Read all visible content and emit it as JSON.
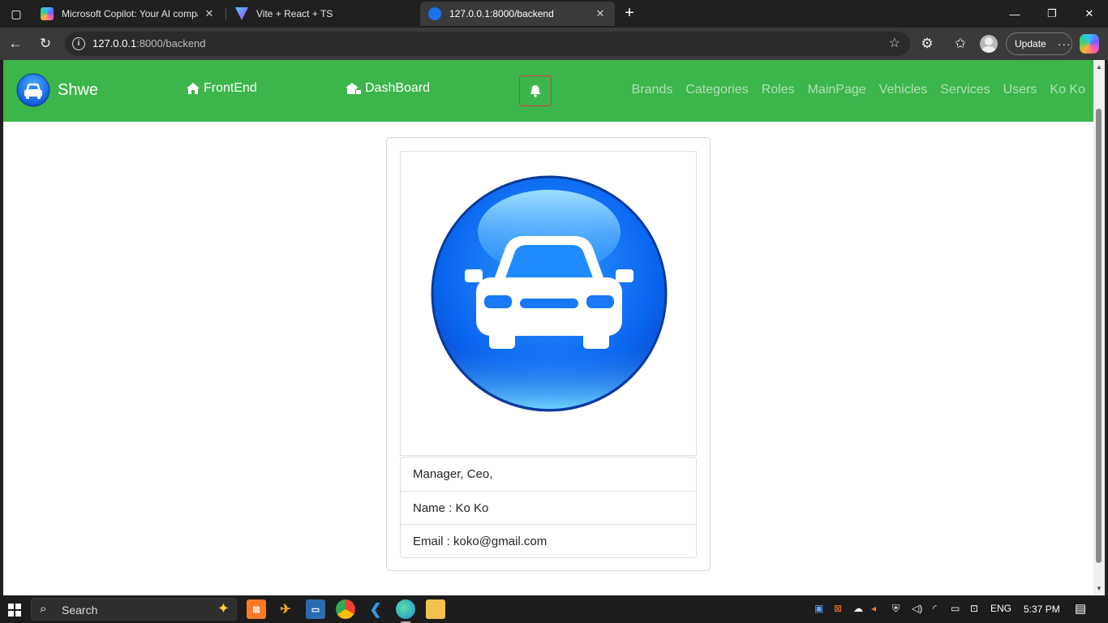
{
  "browser": {
    "tabs": [
      {
        "title": "Microsoft Copilot: Your AI compa",
        "active": false
      },
      {
        "title": "Vite + React + TS",
        "active": false
      },
      {
        "title": "127.0.0.1:8000/backend",
        "active": true
      }
    ],
    "url_host": "127.0.0.1",
    "url_rest": ":8000/backend",
    "update_label": "Update"
  },
  "app": {
    "brand": "Shwe",
    "frontend_label": "FrontEnd",
    "dashboard_label": "DashBoard",
    "menu": [
      "Brands",
      "Categories",
      "Roles",
      "MainPage",
      "Vehicles",
      "Services",
      "Users",
      "Ko Ko"
    ]
  },
  "profile": {
    "roles": "Manager, Ceo,",
    "name_line": "Name : Ko Ko",
    "email_line": "Email : koko@gmail.com"
  },
  "taskbar": {
    "search_label": "Search",
    "lang": "ENG",
    "time": "5:37 PM"
  },
  "colors": {
    "nav_green": "#3cb54a",
    "bell_border": "#dc3545",
    "car_blue": "#0a66f0"
  }
}
